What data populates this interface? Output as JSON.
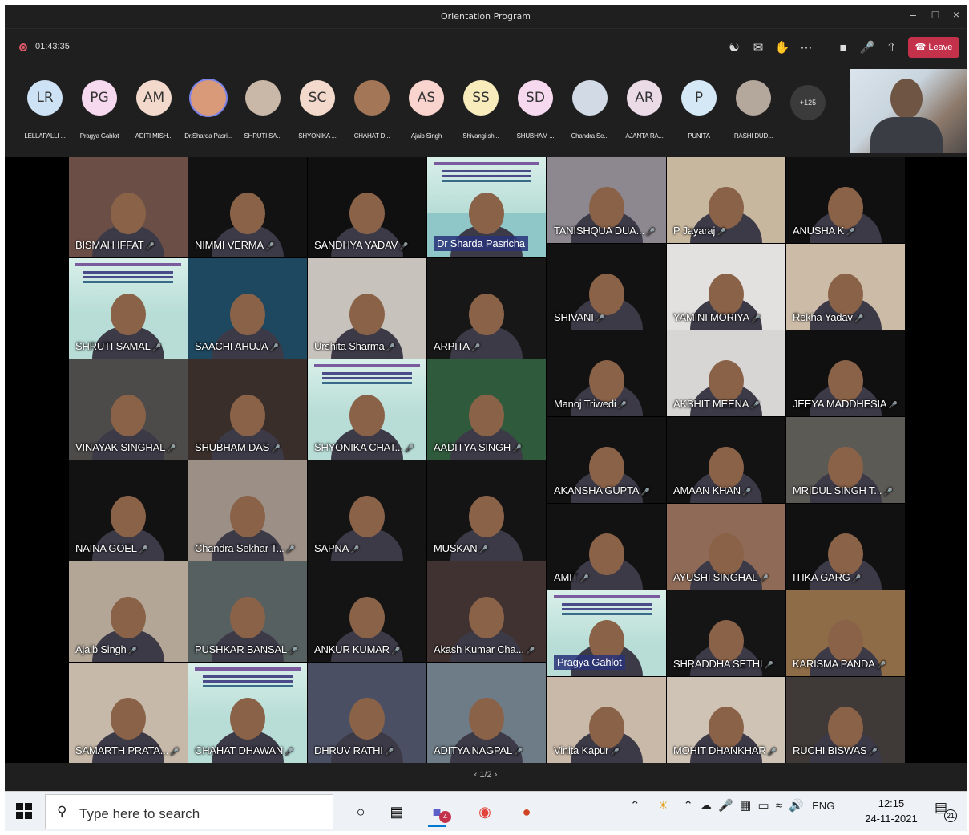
{
  "window": {
    "title": "Orientation Program"
  },
  "meeting": {
    "timer": "01:43:35",
    "leave_label": "Leave"
  },
  "participants_bar": {
    "people": [
      {
        "initials": "LR",
        "name": "LELLAPALLI ...",
        "color": "#cde3f5"
      },
      {
        "initials": "PG",
        "name": "Pragya Gahlot",
        "color": "#f7d9ef"
      },
      {
        "initials": "AM",
        "name": "ADITI MISH...",
        "color": "#f3d9cc"
      },
      {
        "initials": "",
        "name": "Dr.Sharda Pasri...",
        "color": "#d99a7a",
        "photo": true
      },
      {
        "initials": "",
        "name": "SHRUTI SA...",
        "color": "#c9b8a8",
        "photo": true
      },
      {
        "initials": "SC",
        "name": "SHYONIKA ...",
        "color": "#f3d9cc"
      },
      {
        "initials": "",
        "name": "CHAHAT D...",
        "color": "#a27656",
        "photo": true
      },
      {
        "initials": "AS",
        "name": "Ajaib Singh",
        "color": "#f9d3cd"
      },
      {
        "initials": "SS",
        "name": "Shivangi sh...",
        "color": "#f8ecbd"
      },
      {
        "initials": "SD",
        "name": "SHUBHAM ...",
        "color": "#f7d9ef"
      },
      {
        "initials": "",
        "name": "Chandra Se...",
        "color": "#d2dae6",
        "photo": true
      },
      {
        "initials": "AR",
        "name": "AJANTA RA...",
        "color": "#eadbe7"
      },
      {
        "initials": "P",
        "name": "PUNITA",
        "color": "#d5e8f6"
      },
      {
        "initials": "",
        "name": "RASHI DUD...",
        "color": "#b4a79c",
        "photo": true
      }
    ],
    "more_count": "+125"
  },
  "grid": {
    "tiles": [
      {
        "name": "BISMAH IFFAT",
        "bg": "#6b4f46",
        "col": 0,
        "row": 0
      },
      {
        "name": "NIMMI VERMA",
        "bg": "#121212",
        "col": 1,
        "row": 0
      },
      {
        "name": "SANDHYA YADAV",
        "bg": "#101010",
        "col": 2,
        "row": 0
      },
      {
        "name": "Dr Sharda Pasricha",
        "bg": "#8fc7c8",
        "col": 3,
        "row": 0,
        "banner": true,
        "boxed": true
      },
      {
        "name": "SHRUTI SAMAL",
        "bg": "#b7ddd6",
        "col": 0,
        "row": 1,
        "banner": true
      },
      {
        "name": "SAACHI AHUJA",
        "bg": "#1d4860",
        "col": 1,
        "row": 1
      },
      {
        "name": "Urshita Sharma",
        "bg": "#c8c2bc",
        "col": 2,
        "row": 1
      },
      {
        "name": "ARPITA",
        "bg": "#171717",
        "col": 3,
        "row": 1
      },
      {
        "name": "VINAYAK SINGHAL",
        "bg": "#4d4a4a",
        "col": 0,
        "row": 2
      },
      {
        "name": "SHUBHAM DAS",
        "bg": "#3a2e2a",
        "col": 1,
        "row": 2
      },
      {
        "name": "SHYONIKA CHAT...",
        "bg": "#b7ddd6",
        "col": 2,
        "row": 2,
        "banner": true
      },
      {
        "name": "AADITYA SINGH",
        "bg": "#2f5a3c",
        "col": 3,
        "row": 2
      },
      {
        "name": "NAINA GOEL",
        "bg": "#121212",
        "col": 0,
        "row": 3
      },
      {
        "name": "Chandra Sekhar T...",
        "bg": "#9b8f86",
        "col": 1,
        "row": 3
      },
      {
        "name": "SAPNA",
        "bg": "#141414",
        "col": 2,
        "row": 3
      },
      {
        "name": "MUSKAN",
        "bg": "#141414",
        "col": 3,
        "row": 3
      },
      {
        "name": "Ajaib Singh",
        "bg": "#b3a697",
        "col": 0,
        "row": 4
      },
      {
        "name": "PUSHKAR BANSAL",
        "bg": "#566060",
        "col": 1,
        "row": 4
      },
      {
        "name": "ANKUR KUMAR",
        "bg": "#141414",
        "col": 2,
        "row": 4
      },
      {
        "name": "Akash Kumar Cha...",
        "bg": "#3f3230",
        "col": 3,
        "row": 4
      },
      {
        "name": "SAMARTH PRATA...",
        "bg": "#c7b9a9",
        "col": 0,
        "row": 5
      },
      {
        "name": "CHAHAT DHAWAN",
        "bg": "#b7ddd6",
        "col": 1,
        "row": 5,
        "banner": true
      },
      {
        "name": "DHRUV RATHI",
        "bg": "#4b4f64",
        "col": 2,
        "row": 5
      },
      {
        "name": "ADITYA NAGPAL",
        "bg": "#6e7c87",
        "col": 3,
        "row": 5
      }
    ],
    "right_tiles": [
      {
        "name": "TANISHQUA DUA...",
        "bg": "#8d8890",
        "col": 0,
        "row": 0
      },
      {
        "name": "P Jayaraj",
        "bg": "#c7b79f",
        "col": 1,
        "row": 0
      },
      {
        "name": "ANUSHA K",
        "bg": "#101010",
        "col": 2,
        "row": 0
      },
      {
        "name": "SHIVANI",
        "bg": "#121212",
        "col": 0,
        "row": 1
      },
      {
        "name": "YAMINI MORIYA",
        "bg": "#e3e1df",
        "col": 1,
        "row": 1
      },
      {
        "name": "Rekha Yadav",
        "bg": "#ccbba7",
        "col": 2,
        "row": 1
      },
      {
        "name": "Manoj Triwedi",
        "bg": "#121212",
        "col": 0,
        "row": 2
      },
      {
        "name": "AKSHIT MEENA",
        "bg": "#d8d6d4",
        "col": 1,
        "row": 2
      },
      {
        "name": "JEEYA MADDHESIA",
        "bg": "#101010",
        "col": 2,
        "row": 2
      },
      {
        "name": "AKANSHA GUPTA",
        "bg": "#121212",
        "col": 0,
        "row": 3
      },
      {
        "name": "AMAAN KHAN",
        "bg": "#131313",
        "col": 1,
        "row": 3
      },
      {
        "name": "MRIDUL SINGH T...",
        "bg": "#5c5a55",
        "col": 2,
        "row": 3
      },
      {
        "name": "AMIT",
        "bg": "#121212",
        "col": 0,
        "row": 4
      },
      {
        "name": "AYUSHI SINGHAL",
        "bg": "#8f6b57",
        "col": 1,
        "row": 4
      },
      {
        "name": "ITIKA GARG",
        "bg": "#111111",
        "col": 2,
        "row": 4
      },
      {
        "name": "Pragya Gahlot",
        "bg": "#b7ddd6",
        "col": 0,
        "row": 5,
        "banner": true,
        "boxed": true
      },
      {
        "name": "SHRADDHA SETHI",
        "bg": "#151515",
        "col": 1,
        "row": 5
      },
      {
        "name": "KARISMA PANDA",
        "bg": "#8d6c47",
        "col": 2,
        "row": 5
      },
      {
        "name": "Vinita Kapur",
        "bg": "#c9b9a8",
        "col": 0,
        "row": 6
      },
      {
        "name": "MOHIT DHANKHAR",
        "bg": "#cfc3b5",
        "col": 1,
        "row": 6
      },
      {
        "name": "RUCHI BISWAS",
        "bg": "#3f3a38",
        "col": 2,
        "row": 6
      }
    ]
  },
  "pager": {
    "label": "1/2"
  },
  "taskbar": {
    "search_placeholder": "Type here to search",
    "teams_badge": "4",
    "language": "ENG",
    "time": "12:15",
    "date": "24-11-2021",
    "notification_count": "21"
  },
  "colors": {
    "leave": "#c4314b",
    "app_bg": "#1f1f1f",
    "taskbar_bg": "#eef1f5"
  }
}
